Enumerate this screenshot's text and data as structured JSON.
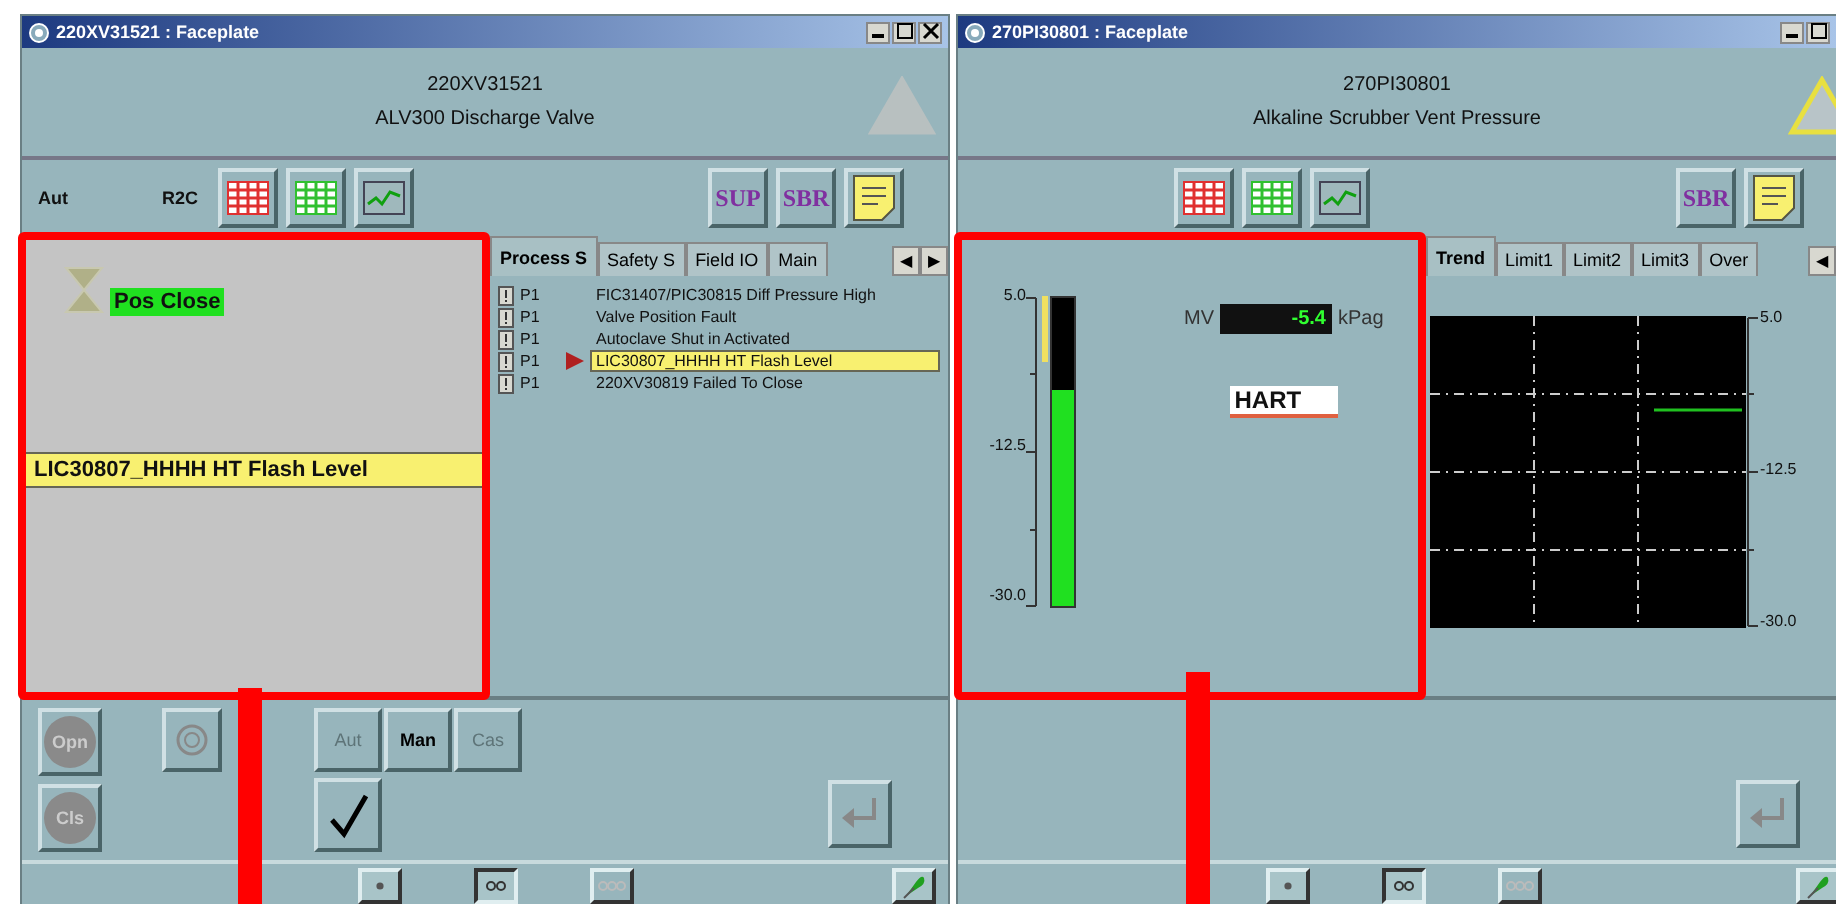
{
  "windows": [
    {
      "title": "220XV31521 : Faceplate",
      "tag": "220XV31521",
      "description": "ALV300 Discharge Valve",
      "alarm_active": false,
      "highlighted": true,
      "mode_labels": [
        "Aut",
        "R2C"
      ],
      "toolbar_left": [
        {
          "kind": "alarms"
        },
        {
          "kind": "events"
        },
        {
          "kind": "trend"
        }
      ],
      "toolbar_right": [
        {
          "kind": "text",
          "label": "SUP"
        },
        {
          "kind": "text",
          "label": "SBR"
        },
        {
          "kind": "note"
        }
      ],
      "panel": {
        "kind": "valve",
        "status": "Pos Close",
        "banner": "LIC30807_HHHH HT Flash Level"
      },
      "tabs": [
        {
          "label": "Process S",
          "selected": true
        },
        {
          "label": "Safety S",
          "selected": false
        },
        {
          "label": "Field IO",
          "selected": false
        },
        {
          "label": "Main",
          "selected": false
        }
      ],
      "tab_scroll": [
        "◀",
        "▶"
      ],
      "content": {
        "kind": "alarms",
        "rows": [
          {
            "priority": "P1",
            "message": "FIC31407/PIC30815 Diff Pressure High",
            "selected": false
          },
          {
            "priority": "P1",
            "message": "Valve Position Fault",
            "selected": false
          },
          {
            "priority": "P1",
            "message": "Autoclave Shut in Activated",
            "selected": false
          },
          {
            "priority": "P1",
            "message": "LIC30807_HHHH HT Flash Level",
            "selected": true
          },
          {
            "priority": "P1",
            "message": "220XV30819 Failed To Close",
            "selected": false
          }
        ]
      },
      "controls": {
        "kind": "valve",
        "round_buttons": [
          "Opn",
          "Cls"
        ],
        "modes": [
          {
            "label": "Aut",
            "disabled": true
          },
          {
            "label": "Man",
            "disabled": false
          },
          {
            "label": "Cas",
            "disabled": true
          }
        ]
      },
      "footer": [
        {
          "kind": "one",
          "selected": false,
          "disabled": false
        },
        {
          "kind": "two",
          "selected": true,
          "disabled": false
        },
        {
          "kind": "three",
          "selected": false,
          "disabled": true
        }
      ]
    },
    {
      "title": "270PI30801 : Faceplate",
      "tag": "270PI30801",
      "description": "Alkaline Scrubber Vent Pressure",
      "alarm_active": true,
      "highlighted": true,
      "toolbar_left": [
        {
          "kind": "alarms"
        },
        {
          "kind": "events"
        },
        {
          "kind": "trend"
        }
      ],
      "toolbar_right": [
        {
          "kind": "text",
          "label": "SBR"
        },
        {
          "kind": "note"
        }
      ],
      "panel": {
        "kind": "gauge",
        "scale": [
          "5.0",
          "-12.5",
          "-30.0"
        ],
        "level": 0.7,
        "mv_label": "MV",
        "mv_value": "-5.4",
        "unit": "kPag",
        "logo": "HART"
      },
      "tabs": [
        {
          "label": "Trend",
          "selected": true
        },
        {
          "label": "Limit1",
          "selected": false
        },
        {
          "label": "Limit2",
          "selected": false
        },
        {
          "label": "Limit3",
          "selected": false
        },
        {
          "label": "Over",
          "selected": false
        }
      ],
      "tab_scroll": [
        "◀"
      ],
      "content": {
        "kind": "trend",
        "scale": [
          "5.0",
          "-12.5",
          "-30.0"
        ]
      },
      "controls": {
        "kind": "indicator"
      },
      "footer": [
        {
          "kind": "one",
          "selected": false,
          "disabled": false
        },
        {
          "kind": "two",
          "selected": true,
          "disabled": false
        },
        {
          "kind": "three",
          "selected": false,
          "disabled": true
        }
      ]
    }
  ]
}
